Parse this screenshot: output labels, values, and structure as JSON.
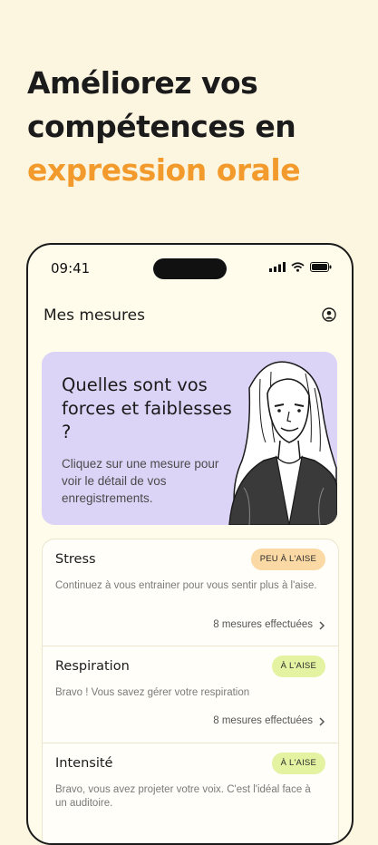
{
  "headline": {
    "line1": "Améliorez vos",
    "line2": "compétences en",
    "line3": "expression orale"
  },
  "status_bar": {
    "time": "09:41"
  },
  "app": {
    "title": "Mes mesures"
  },
  "hero": {
    "title": "Quelles sont vos forces et faiblesses ?",
    "text": "Cliquez sur une mesure pour voir le détail de vos enregistrements."
  },
  "measures": [
    {
      "title": "Stress",
      "badge": "PEU À L'AISE",
      "description": "Continuez à vous entrainer pour vous sentir plus à l'aise.",
      "count": "8 mesures effectuées"
    },
    {
      "title": "Respiration",
      "badge": "À L'AISE",
      "description": "Bravo ! Vous savez gérer votre respiration",
      "count": "8 mesures effectuées"
    },
    {
      "title": "Intensité",
      "badge": "À L'AISE",
      "description": "Bravo, vous avez projeter votre voix. C'est l'idéal face à un auditoire.",
      "count": ""
    }
  ],
  "colors": {
    "accent": "#F29A2B",
    "background": "#FCF6E1",
    "hero_bg": "#DCD4F7",
    "badge_warn": "#FAD9A4",
    "badge_ok": "#E3F3A2"
  }
}
